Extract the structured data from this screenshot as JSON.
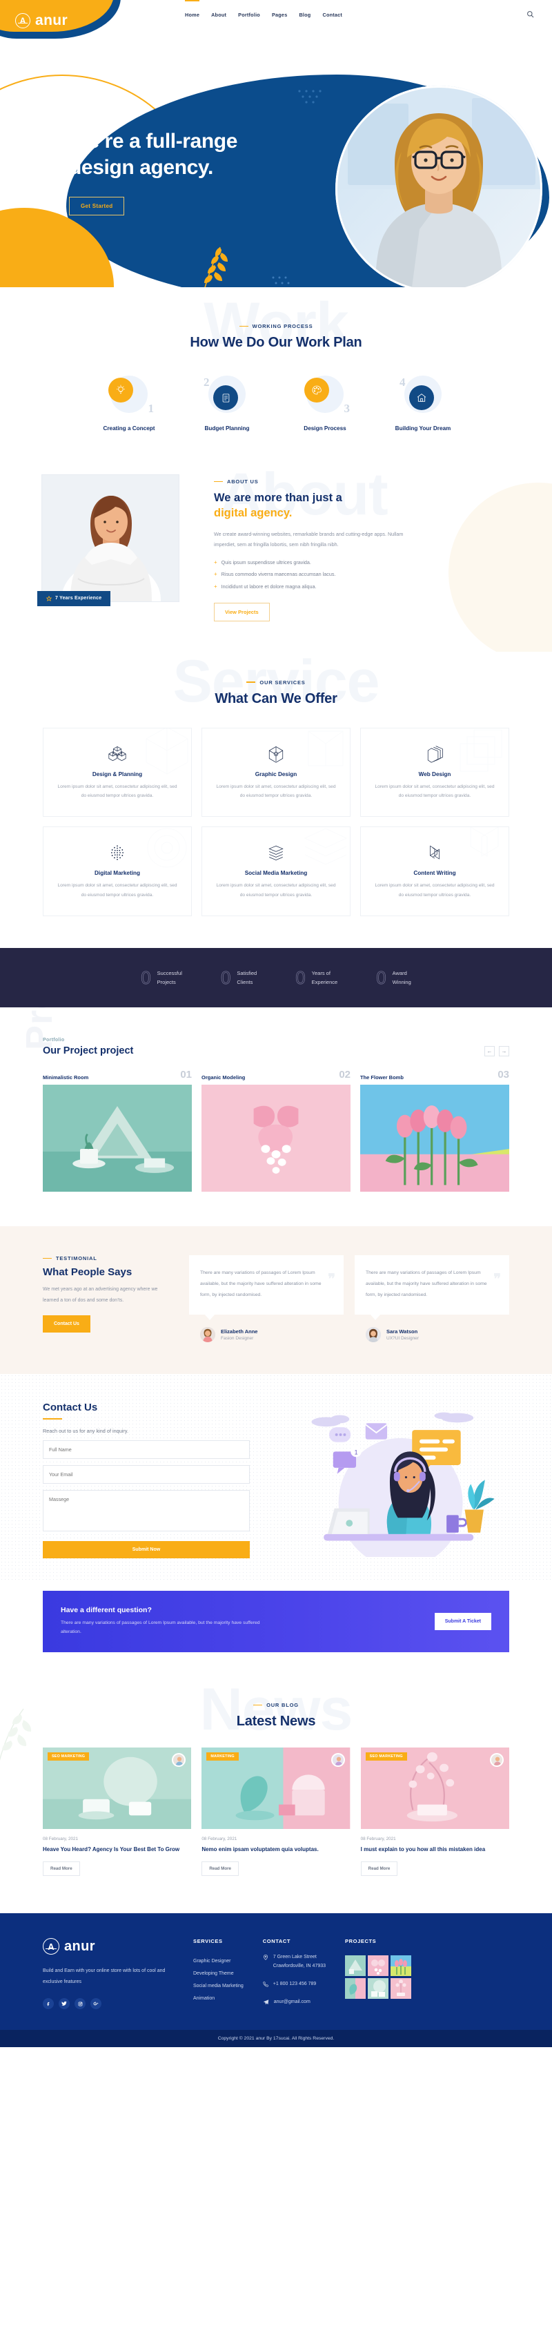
{
  "brand": {
    "name": "anur",
    "mark": "A"
  },
  "nav": {
    "items": [
      {
        "label": "Home",
        "active": true
      },
      {
        "label": "About",
        "active": false
      },
      {
        "label": "Portfolio",
        "active": false
      },
      {
        "label": "Pages",
        "active": false
      },
      {
        "label": "Blog",
        "active": false
      },
      {
        "label": "Contact",
        "active": false
      }
    ],
    "search_icon": "search-icon"
  },
  "hero": {
    "title_line1": "We’re a full-range",
    "title_line2": "design agency.",
    "cta": "Get Started"
  },
  "workplan": {
    "ghost": "Work",
    "eyebrow": "WORKING PROCESS",
    "title": "How We Do Our Work Plan",
    "steps": [
      {
        "num": "1",
        "label": "Creating a Concept",
        "icon": "lightbulb-icon",
        "accent": "#f9ad16",
        "numpos": "br"
      },
      {
        "num": "2",
        "label": "Budget Planning",
        "icon": "document-icon",
        "accent": "#114a85",
        "numpos": "tl"
      },
      {
        "num": "3",
        "label": "Design Process",
        "icon": "palette-icon",
        "accent": "#f9ad16",
        "numpos": "br"
      },
      {
        "num": "4",
        "label": "Building Your Dream",
        "icon": "house-icon",
        "accent": "#114a85",
        "numpos": "tl"
      }
    ]
  },
  "about": {
    "ghost": "About",
    "eyebrow": "ABOUT US",
    "heading_dark": "We are more than just a",
    "heading_yellow": "digital agency.",
    "paragraph": "We create award-winning websites, remarkable brands and cutting-edge apps. Nullam imperdiet, sem at fringilla lobortis, sem nibh fringilla nibh.",
    "bullets": [
      "Quis ipsum suspendisse ultrices gravida.",
      "Risus commodo viverra maecenas accumsan lacus.",
      "Incididunt ut labore et dolore magna aliqua."
    ],
    "badge": "7 Years Experience",
    "button": "View Projects"
  },
  "services": {
    "ghost": "Service",
    "eyebrow": "OUR SERVICES",
    "title": "What Can We Offer",
    "body": "Lorem ipsum dolor sit amet, consectetur adipiscing elit, sed do eiusmod tempor ultrices gravida.",
    "cards": [
      {
        "title": "Design & Planning",
        "icon": "cube-cluster-icon"
      },
      {
        "title": "Graphic Design",
        "icon": "cube-wire-icon"
      },
      {
        "title": "Web Design",
        "icon": "layered-cube-icon"
      },
      {
        "title": "Digital Marketing",
        "icon": "dot-sphere-icon"
      },
      {
        "title": "Social Media Marketing",
        "icon": "stack-icon"
      },
      {
        "title": "Content Writing",
        "icon": "ribbon-icon"
      }
    ]
  },
  "stats": [
    {
      "value": "0",
      "line1": "Successful",
      "line2": "Projects"
    },
    {
      "value": "0",
      "line1": "Satisfied",
      "line2": "Clients"
    },
    {
      "value": "0",
      "line1": "Years of",
      "line2": "Experience"
    },
    {
      "value": "0",
      "line1": "Award",
      "line2": "Winning"
    }
  ],
  "portfolio": {
    "ghost": "Project",
    "eyebrow": "Portfolio",
    "title": "Our Project project",
    "prev_icon": "arrow-left-icon",
    "next_icon": "arrow-right-icon",
    "items": [
      {
        "name": "Minimalistic Room",
        "index": "01"
      },
      {
        "name": "Organic Modeling",
        "index": "02"
      },
      {
        "name": "The Flower Bomb",
        "index": "03"
      }
    ]
  },
  "testimonial": {
    "eyebrow": "TESTIMONIAL",
    "title": "What People Says",
    "paragraph": "We met years ago at an advertising agency where we learned a ton of dos and some don’ts.",
    "button": "Contact Us",
    "cards": [
      {
        "quote": "There are many variations of passages of Lorem Ipsum available, but the majority have suffered alteration in some form, by injected randomised.",
        "name": "Elizabeth Anne",
        "role": "Fasion Designer"
      },
      {
        "quote": "There are many variations of passages of Lorem Ipsum available, but the majority have suffered alteration in some form, by injected randomised.",
        "name": "Sara Watson",
        "role": "UX?UI Designer"
      }
    ]
  },
  "contact": {
    "title": "Contact Us",
    "subtitle": "Reach out to us for any kind of inquiry.",
    "fields": {
      "name_placeholder": "Full Name",
      "email_placeholder": "Your Email",
      "message_placeholder": "Massege"
    },
    "submit": "Submit Now",
    "illustration": "support-agent-illustration"
  },
  "cta": {
    "title": "Have a different question?",
    "text": "There are many variations of passages of Lorem Ipsum available, but the majority have suffered alteration.",
    "button": "Submit A Ticket"
  },
  "blog": {
    "ghost": "News",
    "eyebrow": "OUR BLOG",
    "title": "Latest News",
    "posts": [
      {
        "tag": "SEO MARKETING",
        "date": "08 February, 2021",
        "title": "Heave You Heard? Agency Is Your Best Bet To Grow",
        "button": "Read More"
      },
      {
        "tag": "MARKETING",
        "date": "08 February, 2021",
        "title": "Nemo enim ipsam voluptatem quia voluptas.",
        "button": "Read More"
      },
      {
        "tag": "SEO MARKETING",
        "date": "08 February, 2021",
        "title": "I must explain to you how all this mistaken idea",
        "button": "Read More"
      }
    ]
  },
  "footer": {
    "description": "Build and Earn with your online store with lots of cool and exclusive features",
    "social": [
      {
        "name": "facebook-icon",
        "glyph": "f"
      },
      {
        "name": "twitter-icon",
        "glyph": "✈"
      },
      {
        "name": "instagram-icon",
        "glyph": "▣"
      },
      {
        "name": "google-plus-icon",
        "glyph": "g⁺"
      }
    ],
    "services": {
      "heading": "SERVICES",
      "links": [
        "Graphic Designer",
        "Developing Theme",
        "Social media Marketing",
        "Animation"
      ]
    },
    "contact": {
      "heading": "CONTACT",
      "address_line1": "7 Green Lake Street",
      "address_line2": "Crawfordsville, IN 47933",
      "phone": "+1 800 123 456 789",
      "email": "anur@gmail.com",
      "address_icon": "location-pin-icon",
      "phone_icon": "phone-icon",
      "email_icon": "paper-plane-icon"
    },
    "projects": {
      "heading": "PROJECTS",
      "count": 6
    },
    "copyright": "Copyright © 2021 anur By 17sucai. All Rights Reserved."
  },
  "colors": {
    "primary_blue": "#0b4c8c",
    "deep_navy": "#14306b",
    "accent_yellow": "#f9ad16",
    "stats_bg": "#262645",
    "footer_bg": "#0c2f7e",
    "cta_purple": "#3a3ae0"
  }
}
